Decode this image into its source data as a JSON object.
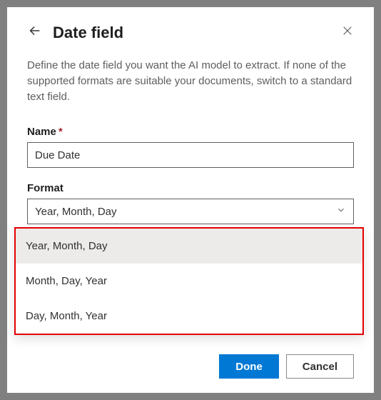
{
  "header": {
    "title": "Date field"
  },
  "description": "Define the date field you want the AI model to extract. If none of the supported formats are suitable your documents, switch to a standard text field.",
  "name_field": {
    "label": "Name",
    "value": "Due Date"
  },
  "format_field": {
    "label": "Format",
    "selected": "Year, Month, Day",
    "options": [
      "Year, Month, Day",
      "Month, Day, Year",
      "Day, Month, Year"
    ]
  },
  "footer": {
    "done": "Done",
    "cancel": "Cancel"
  }
}
